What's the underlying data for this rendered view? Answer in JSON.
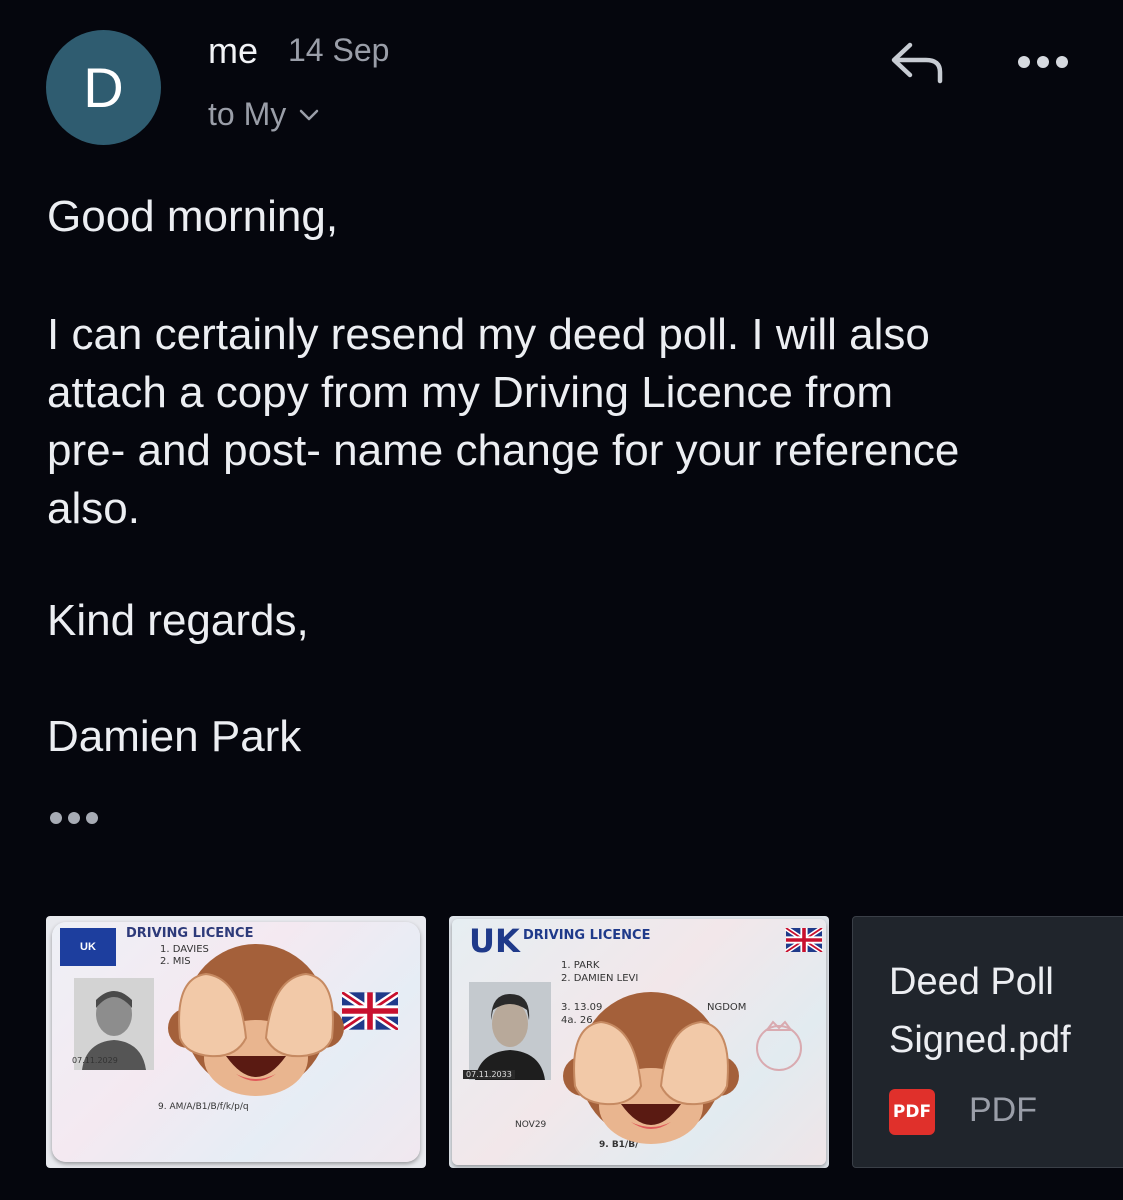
{
  "header": {
    "avatar_letter": "D",
    "sender": "me",
    "date": "14 Sep",
    "recipient": "to My",
    "icons": [
      "reply-icon",
      "more-options-icon",
      "chevron-down-icon"
    ]
  },
  "body": {
    "greeting": "Good morning,",
    "paragraph_line1": "I can certainly resend my deed poll.  I will also",
    "paragraph_line2": "attach a copy from my Driving Licence from",
    "paragraph_line3": "pre- and post- name change for your reference",
    "paragraph_line4": "also.",
    "closing": "Kind regards,",
    "signature": "Damien Park"
  },
  "attachments": {
    "licence_old": {
      "title": "DRIVING LICENCE",
      "flag_text": "UK",
      "line1": "1.  DAVIES",
      "line2": "2.  MIS",
      "date_text": "07.11.2029",
      "categories": "9.   AM/A/B1/B/f/k/p/q"
    },
    "licence_new": {
      "country": "UK",
      "title": "DRIVING LICENCE",
      "line1": "1.  PARK",
      "line2": "2.  DAMIEN LEVI",
      "line3": "3.  13.09",
      "line4": "4a. 26",
      "country_tail": "NGDOM",
      "date_text": "07.11.2033",
      "sig_text": "NOV29",
      "categories": "9.   B1/B/"
    },
    "pdf": {
      "name_line1": "Deed Poll",
      "name_line2": "Signed.pdf",
      "badge": "PDF",
      "type": "PDF"
    }
  },
  "colors": {
    "background": "#05060d",
    "avatar": "#2f5c70",
    "secondary_text": "#9a9ea8",
    "pdf_red": "#e0302b",
    "pdf_card": "#20252c"
  }
}
